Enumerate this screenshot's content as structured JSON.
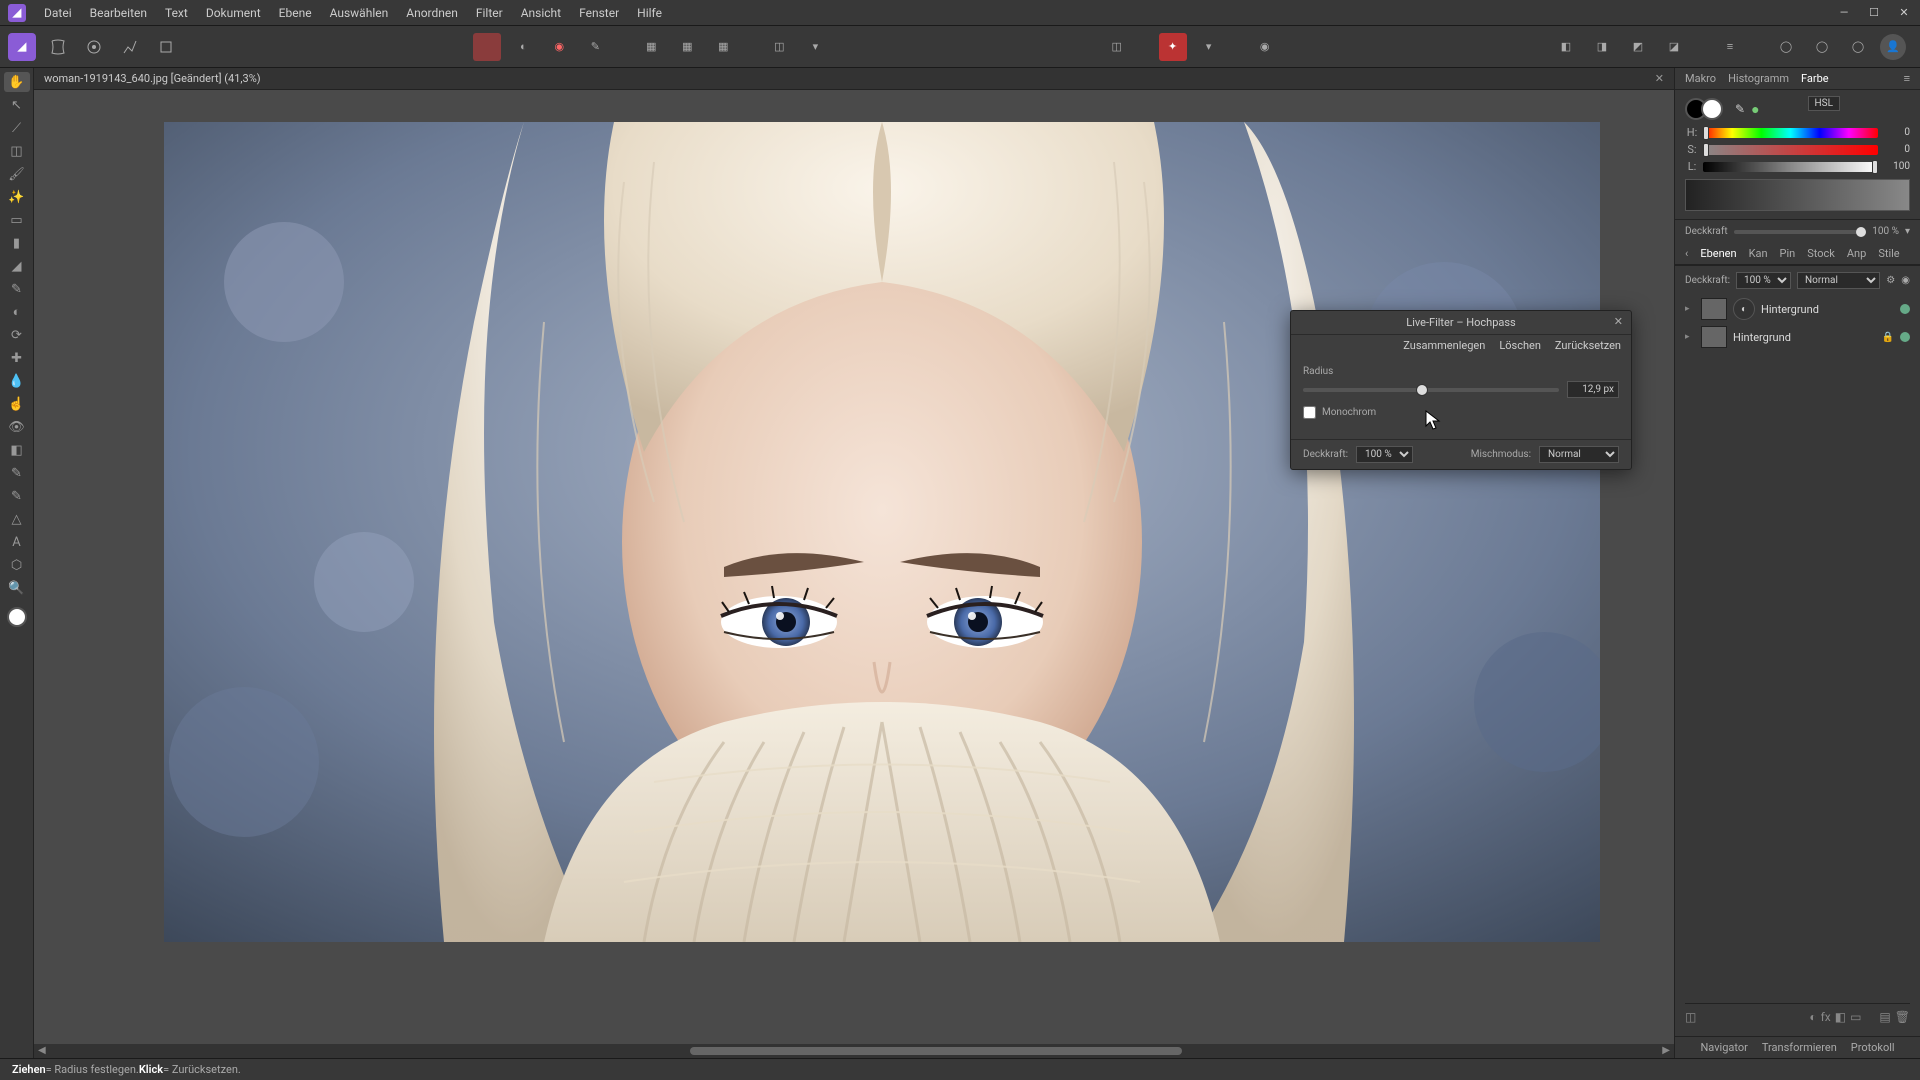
{
  "menu": {
    "items": [
      "Datei",
      "Bearbeiten",
      "Text",
      "Dokument",
      "Ebene",
      "Auswählen",
      "Anordnen",
      "Filter",
      "Ansicht",
      "Fenster",
      "Hilfe"
    ]
  },
  "doc_tab": "woman-1919143_640.jpg [Geändert] (41,3%)",
  "dialog": {
    "title": "Live-Filter – Hochpass",
    "merge": "Zusammenlegen",
    "delete": "Löschen",
    "reset": "Zurücksetzen",
    "radius_label": "Radius",
    "radius_value": "12,9 px",
    "monochrome": "Monochrom",
    "opacity_label": "Deckkraft:",
    "opacity_value": "100 %",
    "blend_label": "Mischmodus:",
    "blend_value": "Normal"
  },
  "top_tabs": {
    "makro": "Makro",
    "histogramm": "Histogramm",
    "farbe": "Farbe"
  },
  "color": {
    "mode": "HSL",
    "h_label": "H:",
    "s_label": "S:",
    "l_label": "L:",
    "h_val": "0",
    "s_val": "0",
    "l_val": "100"
  },
  "opacity_section": {
    "label": "Deckkraft",
    "value": "100 %"
  },
  "layer_tabs": {
    "ebenen": "Ebenen",
    "kan": "Kan",
    "pin": "Pin",
    "stock": "Stock",
    "anp": "Anp",
    "stile": "Stile"
  },
  "layer_ctrl": {
    "opacity_label": "Deckkraft:",
    "opacity_value": "100 %",
    "blend": "Normal"
  },
  "layers": [
    {
      "name": "Hintergrund"
    },
    {
      "name": "Hintergrund"
    }
  ],
  "bottom_tabs": {
    "navigator": "Navigator",
    "transform": "Transformieren",
    "protokoll": "Protokoll"
  },
  "status": {
    "drag": "Ziehen",
    "drag_txt": " = Radius festlegen. ",
    "click": "Klick",
    "click_txt": " = Zurücksetzen."
  }
}
